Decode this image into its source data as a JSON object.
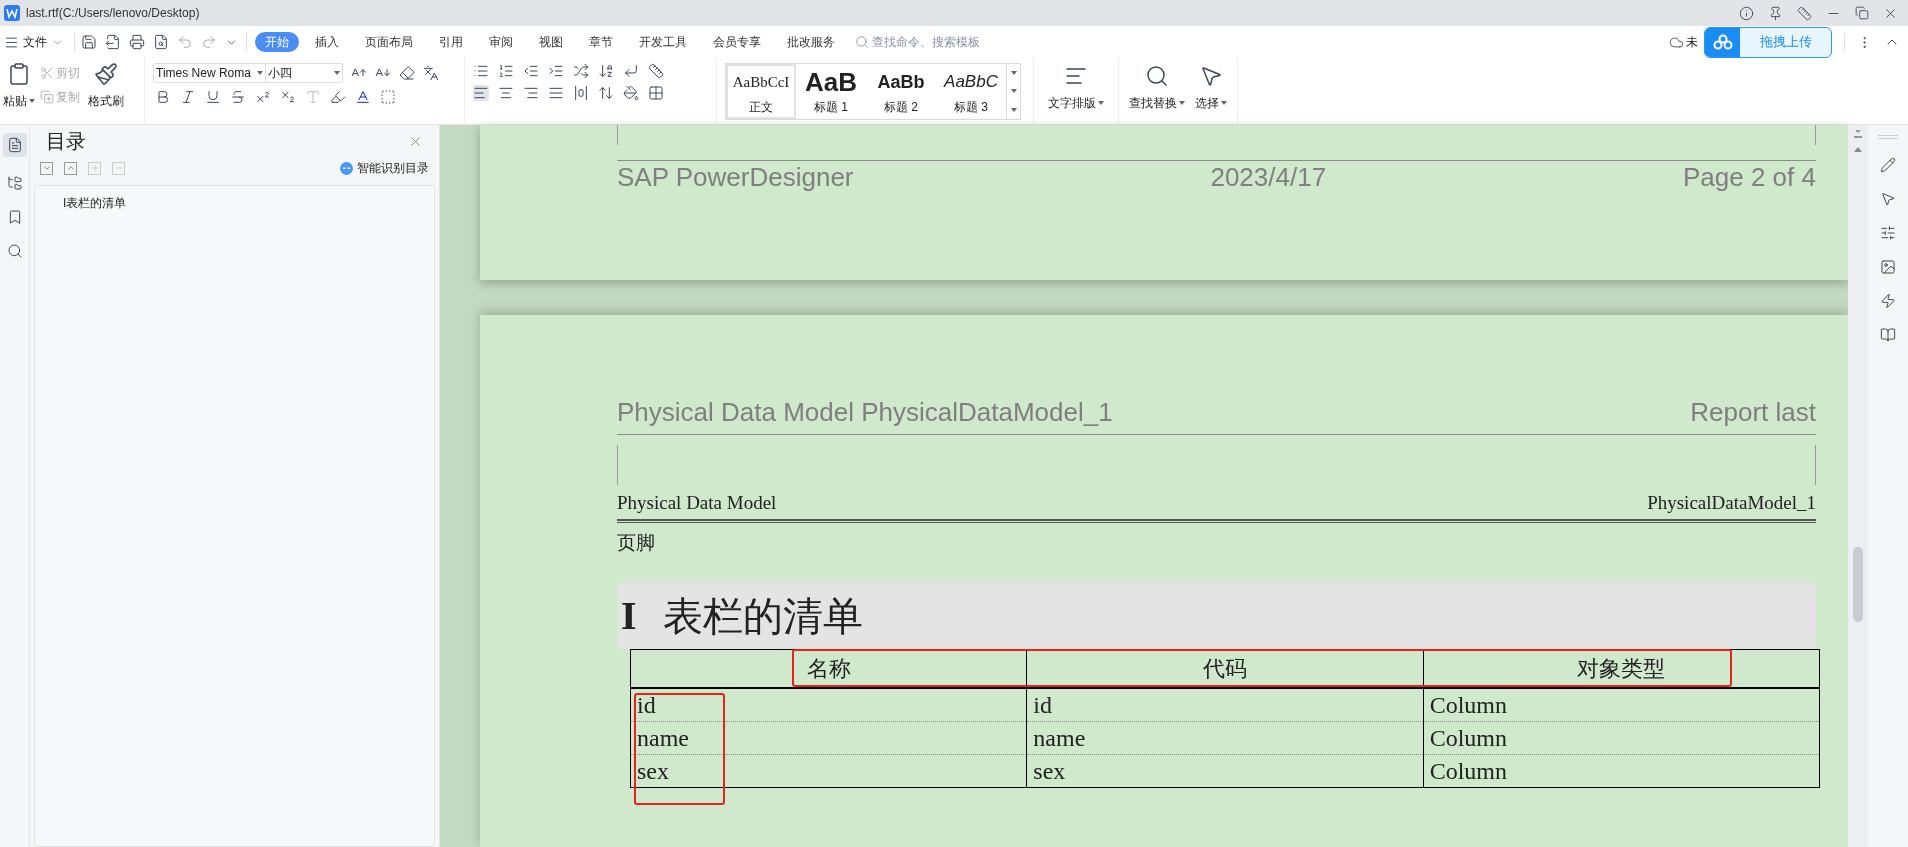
{
  "title": "last.rtf(C:/Users/lenovo/Desktop)",
  "menu": {
    "file": "文件",
    "tabs": [
      {
        "label": "开始",
        "selected": true
      },
      {
        "label": "插入",
        "selected": false
      },
      {
        "label": "页面布局",
        "selected": false
      },
      {
        "label": "引用",
        "selected": false
      },
      {
        "label": "审阅",
        "selected": false
      },
      {
        "label": "视图",
        "selected": false
      },
      {
        "label": "章节",
        "selected": false
      },
      {
        "label": "开发工具",
        "selected": false
      },
      {
        "label": "会员专享",
        "selected": false
      },
      {
        "label": "批改服务",
        "selected": false
      }
    ],
    "search_placeholder": "查找命令、搜索模板",
    "cloud_status": "未",
    "upload_button": "拖拽上传"
  },
  "ribbon": {
    "paste": "粘贴",
    "cut": "剪切",
    "copy": "复制",
    "format_painter": "格式刷",
    "font_name": "Times New Roma",
    "font_size": "小四",
    "styles": [
      {
        "preview": "AaBbCcI",
        "label": "正文",
        "kind": "normal",
        "selected": true
      },
      {
        "preview": "AaB",
        "label": "标题 1",
        "kind": "heading1",
        "selected": false
      },
      {
        "preview": "AaBb",
        "label": "标题 2",
        "kind": "heading2",
        "selected": false
      },
      {
        "preview": "AaBbC",
        "label": "标题 3",
        "kind": "heading3",
        "selected": false
      }
    ],
    "text_layout": "文字排版",
    "find_replace": "查找替换",
    "select": "选择"
  },
  "sidebar": {
    "title": "目录",
    "smart_toc": "智能识别目录",
    "items": [
      {
        "label": "I表栏的清单"
      }
    ]
  },
  "document": {
    "page_footer": {
      "left": "SAP PowerDesigner",
      "center": "2023/4/17",
      "right": "Page 2 of 4"
    },
    "page_header": {
      "left": "Physical Data Model PhysicalDataModel_1",
      "right": "Report last"
    },
    "section_header": {
      "left": "Physical Data Model",
      "right": "PhysicalDataModel_1"
    },
    "footer_label": "页脚",
    "heading": {
      "number": "I",
      "title": "表栏的清单"
    },
    "table": {
      "columns": [
        "名称",
        "代码",
        "对象类型"
      ],
      "rows": [
        [
          "id",
          "id",
          "Column"
        ],
        [
          "name",
          "name",
          "Column"
        ],
        [
          "sex",
          "sex",
          "Column"
        ]
      ]
    }
  }
}
